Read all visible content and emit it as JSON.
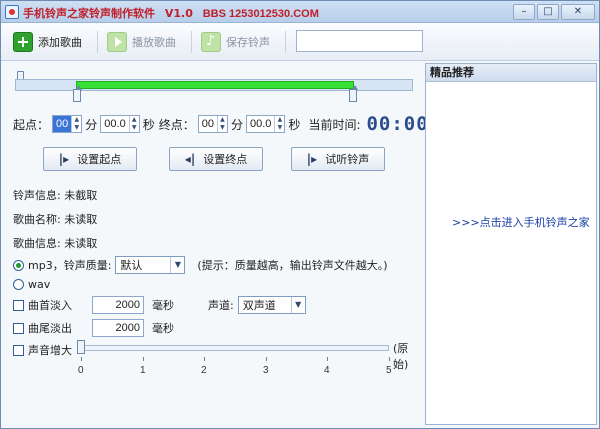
{
  "title": {
    "name": "手机铃声之家铃声制作软件",
    "version": "V1.0",
    "bbs": "BBS 1253012530.COM",
    "minimize": "–",
    "maximize": "□",
    "close": "✕"
  },
  "toolbar": {
    "add_label": "添加歌曲",
    "play_label": "播放歌曲",
    "save_label": "保存铃声",
    "search_value": ""
  },
  "time": {
    "start_label": "起点：",
    "start_min": "00",
    "min_unit": "分",
    "start_sec": "00.0",
    "sec_unit": "秒",
    "end_label": "终点：",
    "end_min": "00",
    "end_sec": "00.0",
    "current_label": "当前时间:",
    "current_value": "00:00"
  },
  "actions": {
    "set_start": "设置起点",
    "set_end": "设置终点",
    "preview": "试听铃声"
  },
  "info": {
    "ringtone": "铃声信息: 未截取",
    "song_name": "歌曲名称: 未读取",
    "song_info": "歌曲信息: 未读取"
  },
  "format": {
    "mp3_label": "mp3，铃声质量:",
    "quality_value": "默认",
    "hint": "(提示：质量越高，输出铃声文件越大。)",
    "wav_label": "wav"
  },
  "fade": {
    "fade_in_label": "曲首淡入",
    "fade_in_value": "2000",
    "fade_out_label": "曲尾淡出",
    "fade_out_value": "2000",
    "ms_unit": "毫秒",
    "channel_label": "声道:",
    "channel_value": "双声道"
  },
  "volume": {
    "label": "声音增大",
    "original": "(原始)",
    "ticks": [
      "0",
      "1",
      "2",
      "3",
      "4",
      "5"
    ],
    "level": 0
  },
  "sidebar": {
    "header": "精品推荐",
    "link": ">>>点击进入手机铃声之家"
  }
}
